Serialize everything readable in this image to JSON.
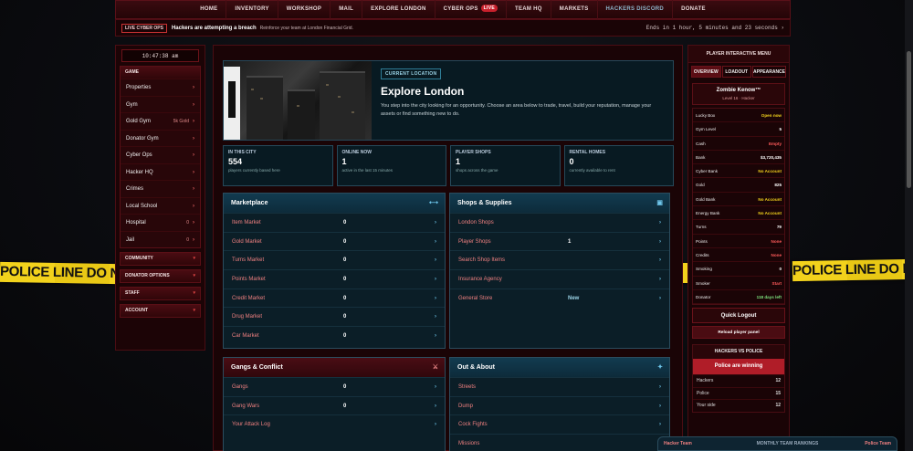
{
  "tape_text": "POLICE LINE DO NOT CROSS",
  "nav": [
    {
      "label": "HOME"
    },
    {
      "label": "INVENTORY"
    },
    {
      "label": "WORKSHOP"
    },
    {
      "label": "MAIL"
    },
    {
      "label": "EXPLORE LONDON"
    },
    {
      "label": "CYBER OPS",
      "badge": "LIVE"
    },
    {
      "label": "TEAM HQ"
    },
    {
      "label": "MARKETS"
    },
    {
      "label": "HACKERS DISCORD"
    },
    {
      "label": "DONATE"
    }
  ],
  "ticker": {
    "badge": "LIVE CYBER OPS",
    "headline": "Hackers are attempting a breach",
    "sub": "Reinforce your team at London Financial Grid.",
    "ends": "Ends in 1 hour, 5 minutes and 23 seconds ›"
  },
  "sidebar": {
    "clock": "10:47:38 am",
    "game_title": "GAME",
    "items": [
      {
        "label": "Properties",
        "value": ""
      },
      {
        "label": "Gym",
        "value": ""
      },
      {
        "label": "Gold Gym",
        "value": "5k Gold"
      },
      {
        "label": "Donator Gym",
        "value": ""
      },
      {
        "label": "Cyber Ops",
        "value": ""
      },
      {
        "label": "Hacker HQ",
        "value": ""
      },
      {
        "label": "Crimes",
        "value": ""
      },
      {
        "label": "Local School",
        "value": ""
      },
      {
        "label": "Hospital",
        "value": "0"
      },
      {
        "label": "Jail",
        "value": "0"
      }
    ],
    "sections": [
      "COMMUNITY",
      "DONATOR OPTIONS",
      "STAFF",
      "ACCOUNT"
    ]
  },
  "hero": {
    "badge": "CURRENT LOCATION",
    "title": "Explore London",
    "desc": "You step into the city looking for an opportunity. Choose an area below to trade, travel, build your reputation, manage your assets or find something new to do."
  },
  "stats": [
    {
      "title": "IN THIS CITY",
      "value": "554",
      "desc": "players currently based here"
    },
    {
      "title": "ONLINE NOW",
      "value": "1",
      "desc": "active in the last 15 minutes"
    },
    {
      "title": "PLAYER SHOPS",
      "value": "1",
      "desc": "shops across the game"
    },
    {
      "title": "RENTAL HOMES",
      "value": "0",
      "desc": "currently available to rent"
    }
  ],
  "marketplace": {
    "title": "Marketplace",
    "rows": [
      {
        "label": "Item Market",
        "value": "0"
      },
      {
        "label": "Gold Market",
        "value": "0"
      },
      {
        "label": "Turns Market",
        "value": "0"
      },
      {
        "label": "Points Market",
        "value": "0"
      },
      {
        "label": "Credit Market",
        "value": "0"
      },
      {
        "label": "Drug Market",
        "value": "0"
      },
      {
        "label": "Car Market",
        "value": "0"
      }
    ]
  },
  "shops": {
    "title": "Shops & Supplies",
    "rows": [
      {
        "label": "London Shops",
        "value": ""
      },
      {
        "label": "Player Shops",
        "value": "1"
      },
      {
        "label": "Search Shop Items",
        "value": ""
      },
      {
        "label": "Insurance Agency",
        "value": ""
      },
      {
        "label": "General Store",
        "value": "New"
      }
    ]
  },
  "gangs": {
    "title": "Gangs & Conflict",
    "rows": [
      {
        "label": "Gangs",
        "value": "0"
      },
      {
        "label": "Gang Wars",
        "value": "0"
      },
      {
        "label": "Your Attack Log",
        "value": ""
      }
    ]
  },
  "out": {
    "title": "Out & About",
    "rows": [
      {
        "label": "Streets",
        "value": ""
      },
      {
        "label": "Dump",
        "value": ""
      },
      {
        "label": "Cock Fights",
        "value": ""
      },
      {
        "label": "Missions",
        "value": ""
      }
    ]
  },
  "right": {
    "header": "PLAYER INTERACTIVE MENU",
    "tabs": [
      "OVERVIEW",
      "LOADOUT",
      "APPEARANCE"
    ],
    "name": "Zombie Kenow™",
    "level": "Level 16 · Hacker",
    "rows": [
      {
        "label": "Lucky Box",
        "value": "Open now",
        "color": "yellow"
      },
      {
        "label": "Gym Level",
        "value": "5",
        "color": ""
      },
      {
        "label": "Cash",
        "value": "Empty",
        "color": "red"
      },
      {
        "label": "Bank",
        "value": "$3,720,435",
        "color": ""
      },
      {
        "label": "Cyber Bank",
        "value": "No Account",
        "color": "yellow"
      },
      {
        "label": "Gold",
        "value": "825",
        "color": ""
      },
      {
        "label": "Gold Bank",
        "value": "No Account",
        "color": "yellow"
      },
      {
        "label": "Energy Bank",
        "value": "No Account",
        "color": "yellow"
      },
      {
        "label": "Turns",
        "value": "79",
        "color": ""
      },
      {
        "label": "Points",
        "value": "None",
        "color": "red"
      },
      {
        "label": "Credits",
        "value": "None",
        "color": "red"
      },
      {
        "label": "Smoking",
        "value": "0",
        "color": ""
      },
      {
        "label": "Smoker",
        "value": "Start",
        "color": "red"
      },
      {
        "label": "Donator",
        "value": "118 days left",
        "color": "green"
      }
    ],
    "quick": "Quick Logout",
    "reload": "Reload player panel",
    "hvp_title": "HACKERS VS POLICE",
    "hvp_banner": "Police are winning",
    "hvp_rows": [
      {
        "label": "Hackers",
        "value": "12"
      },
      {
        "label": "Police",
        "value": "15"
      },
      {
        "label": "Your side",
        "value": "12"
      }
    ]
  },
  "rank": {
    "left": "Hacker Team",
    "center": "MONTHLY TEAM RANKINGS",
    "right": "Police Team"
  }
}
